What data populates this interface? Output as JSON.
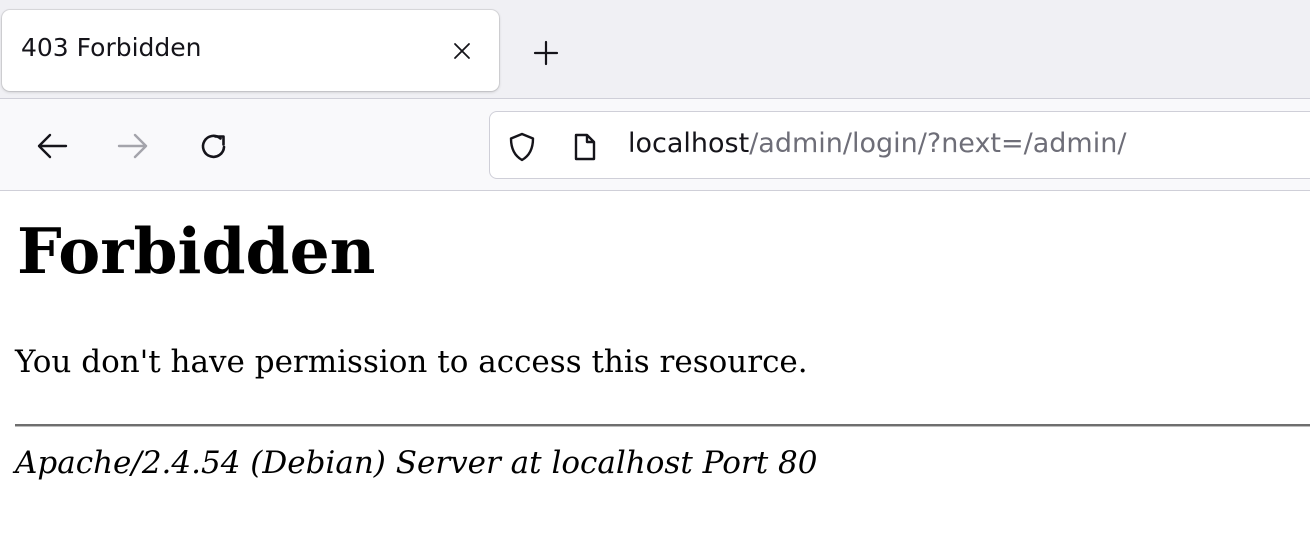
{
  "tab": {
    "title": "403 Forbidden",
    "close_icon": "close-icon",
    "new_tab_icon": "plus-icon"
  },
  "navigation": {
    "back_icon": "arrow-left-icon",
    "forward_icon": "arrow-right-icon",
    "reload_icon": "reload-icon"
  },
  "urlbar": {
    "shield_icon": "shield-icon",
    "page_icon": "page-icon",
    "host": "localhost",
    "path": "/admin/login/?next=/admin/"
  },
  "page": {
    "heading": "Forbidden",
    "message": "You don't have permission to access this resource.",
    "server_signature": "Apache/2.4.54 (Debian) Server at localhost Port 80"
  },
  "colors": {
    "tabbar_bg": "#f0f0f4",
    "navbar_bg": "#f9f9fb",
    "url_path": "#6e6e78",
    "text": "#15141a"
  }
}
